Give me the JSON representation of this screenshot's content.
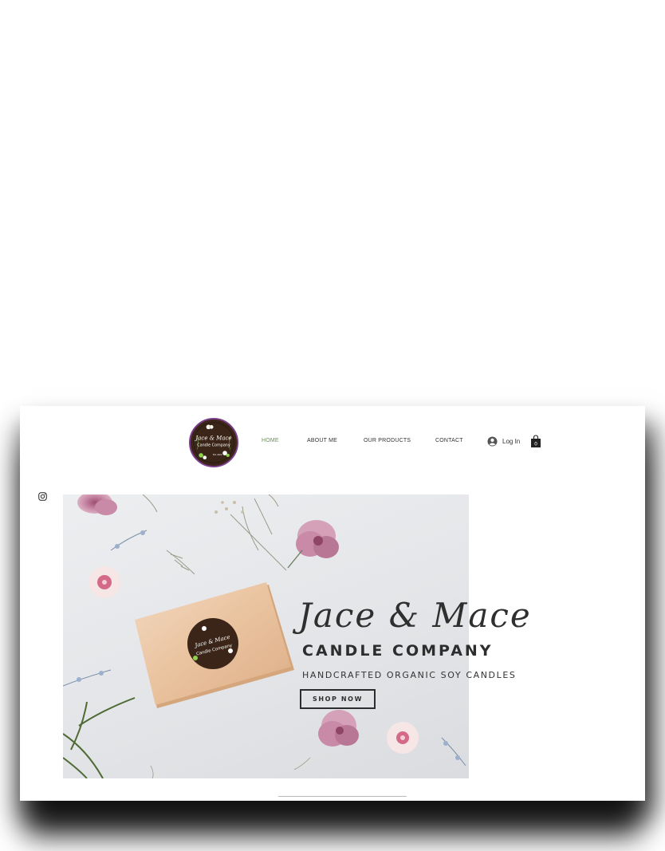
{
  "site": {
    "logo_alt": "Jace & Mace Candle Company logo",
    "logo_text_line1": "Jace & Mace",
    "logo_text_line2": "Candle Company",
    "logo_text_line3": "Est. 2020"
  },
  "nav": {
    "items": [
      {
        "label": "HOME",
        "active": true
      },
      {
        "label": "ABOUT ME",
        "active": false
      },
      {
        "label": "OUR PRODUCTS",
        "active": false
      },
      {
        "label": "CONTACT",
        "active": false
      }
    ],
    "login_label": "Log In",
    "cart_count": "0"
  },
  "hero": {
    "title_script": "Jace & Mace",
    "title_caps": "CANDLE COMPANY",
    "tagline": "HANDCRAFTED ORGANIC SOY CANDLES",
    "cta_label": "SHOP NOW"
  },
  "colors": {
    "nav_active": "#6b8f5a",
    "logo_bg": "#3a2418",
    "logo_ring": "#7a3e8a",
    "text_dark": "#2d2d2d",
    "flower_pink": "#c98aa8",
    "soap": "#ecc8a7"
  },
  "icons": {
    "social": "instagram-icon",
    "login": "user-avatar-icon",
    "cart": "shopping-bag-icon"
  }
}
